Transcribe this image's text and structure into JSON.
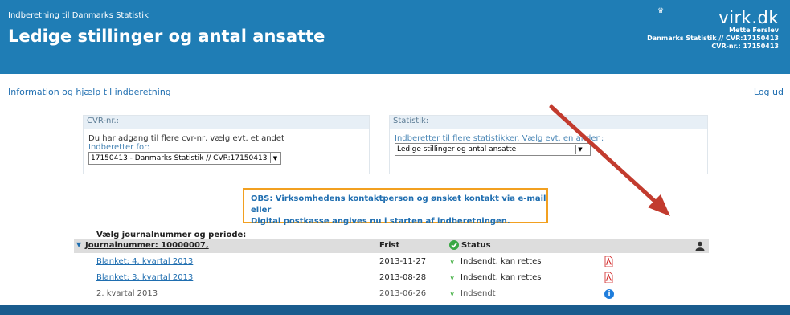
{
  "header": {
    "subtitle": "Indberetning til Danmarks Statistik",
    "title": "Ledige stillinger og antal ansatte",
    "logo_text": "virk.dk",
    "user_name": "Mette Ferslev",
    "org_line": "Danmarks Statistik // CVR:17150413",
    "cvr_line": "CVR-nr.: 17150413"
  },
  "links": {
    "info": "Information og hjælp til indberetning",
    "logout": "Log ud"
  },
  "cvr_panel": {
    "heading": "CVR-nr.:",
    "text": "Du har adgang til flere cvr-nr, vælg evt. et andet",
    "label": "Indberetter for:",
    "selected": "17150413 - Danmarks Statistik // CVR:17150413"
  },
  "stat_panel": {
    "heading": "Statistik:",
    "label": "Indberetter til flere statistikker. Vælg evt. en anden:",
    "selected": "Ledige stillinger og antal ansatte"
  },
  "notice": {
    "line1": "OBS: Virksomhedens kontaktperson og ønsket kontakt via e-mail eller",
    "line2": "Digital postkasse angives nu i starten af indberetningen."
  },
  "journal": {
    "choose_label": "Vælg journalnummer og periode:",
    "journal_link": "Journalnummer: 10000007,",
    "col_deadline": "Frist",
    "col_status": "Status",
    "rows": [
      {
        "name": "Blanket: 4. kvartal 2013",
        "deadline": "2013-11-27",
        "status": "Indsendt, kan rettes",
        "icon": "pdf-icon",
        "link": true
      },
      {
        "name": "Blanket: 3. kvartal 2013",
        "deadline": "2013-08-28",
        "status": "Indsendt, kan rettes",
        "icon": "pdf-icon",
        "link": true
      },
      {
        "name": "2. kvartal 2013",
        "deadline": "2013-06-26",
        "status": "Indsendt",
        "icon": "info-icon",
        "link": false
      }
    ]
  },
  "colors": {
    "header_bg": "#1f7db5",
    "link": "#1f6eb0",
    "notice_border": "#f2a020",
    "arrow": "#c23b2e"
  }
}
